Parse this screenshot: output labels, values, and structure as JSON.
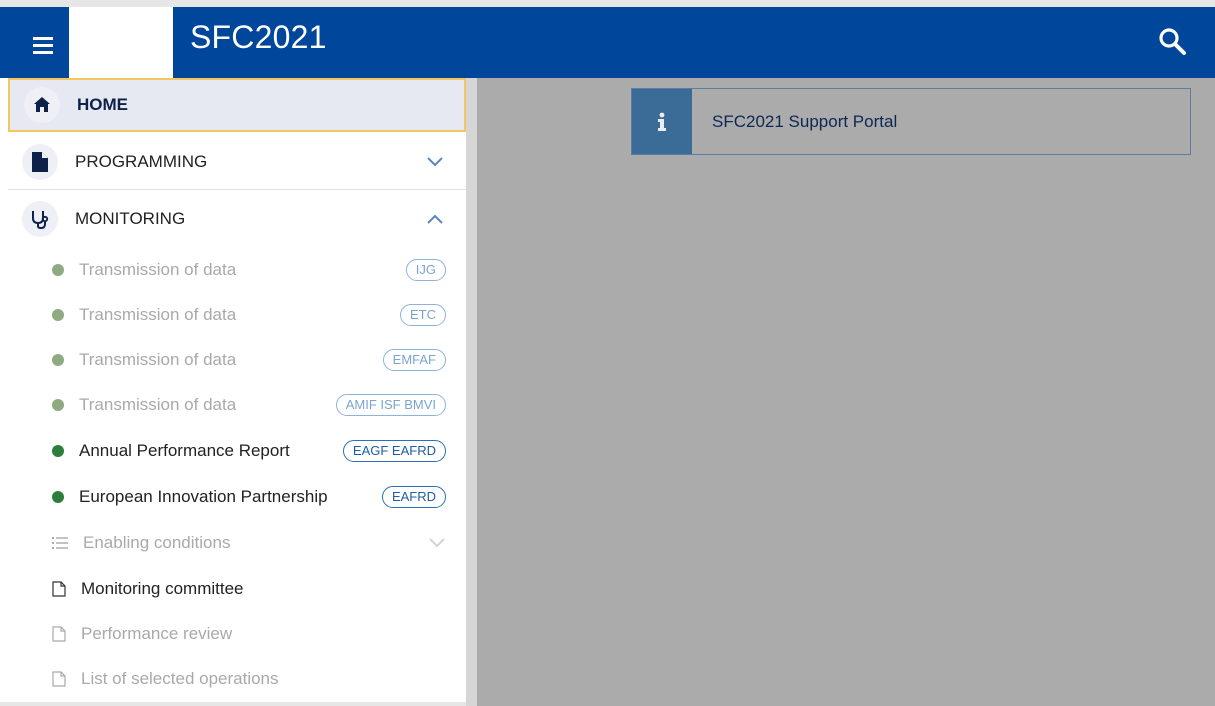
{
  "header": {
    "title": "SFC2021",
    "brand_color": "#00469b"
  },
  "sidebar": {
    "home": {
      "label": "HOME",
      "icon": "home-icon"
    },
    "programming": {
      "label": "PROGRAMMING",
      "icon": "document-icon",
      "state": "collapsed"
    },
    "monitoring": {
      "label": "MONITORING",
      "icon": "stethoscope-icon",
      "state": "expanded",
      "items": [
        {
          "label": "Transmission of data",
          "badge": "IJG",
          "enabled": false
        },
        {
          "label": "Transmission of data",
          "badge": "ETC",
          "enabled": false
        },
        {
          "label": "Transmission of data",
          "badge": "EMFAF",
          "enabled": false
        },
        {
          "label": "Transmission of data",
          "badge": "AMIF ISF BMVI",
          "enabled": false
        },
        {
          "label": "Annual Performance Report",
          "badge": "EAGF EAFRD",
          "enabled": true
        },
        {
          "label": "European Innovation Partnership",
          "badge": "EAFRD",
          "enabled": true
        },
        {
          "label": "Enabling conditions",
          "icon": "list-icon",
          "enabled": false
        },
        {
          "label": "Monitoring committee",
          "icon": "document-outline-icon",
          "enabled": true
        },
        {
          "label": "Performance review",
          "icon": "document-outline-icon",
          "enabled": false
        },
        {
          "label": "List of selected operations",
          "icon": "document-outline-icon",
          "enabled": false
        }
      ]
    }
  },
  "main": {
    "info_banner": {
      "icon": "info-icon",
      "label": "SFC2021 Support Portal"
    }
  }
}
